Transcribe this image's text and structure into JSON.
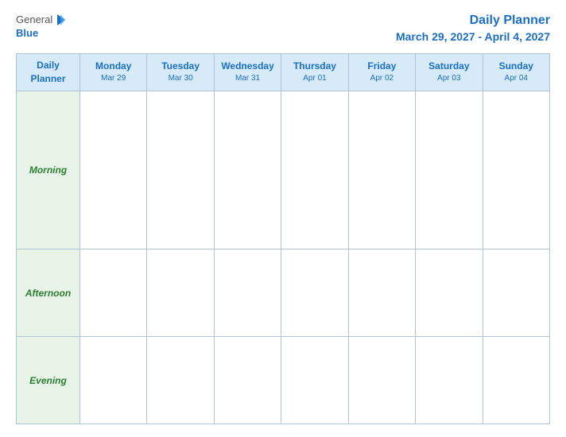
{
  "header": {
    "logo": {
      "general": "General",
      "blue": "Blue",
      "icon": "▶"
    },
    "title": "Daily Planner",
    "date_range": "March 29, 2027 - April 4, 2027"
  },
  "table": {
    "header_label_line1": "Daily",
    "header_label_line2": "Planner",
    "columns": [
      {
        "day": "Monday",
        "date": "Mar 29"
      },
      {
        "day": "Tuesday",
        "date": "Mar 30"
      },
      {
        "day": "Wednesday",
        "date": "Mar 31"
      },
      {
        "day": "Thursday",
        "date": "Apr 01"
      },
      {
        "day": "Friday",
        "date": "Apr 02"
      },
      {
        "day": "Saturday",
        "date": "Apr 03"
      },
      {
        "day": "Sunday",
        "date": "Apr 04"
      }
    ],
    "rows": [
      {
        "label": "Morning"
      },
      {
        "label": "Afternoon"
      },
      {
        "label": "Evening"
      }
    ]
  }
}
